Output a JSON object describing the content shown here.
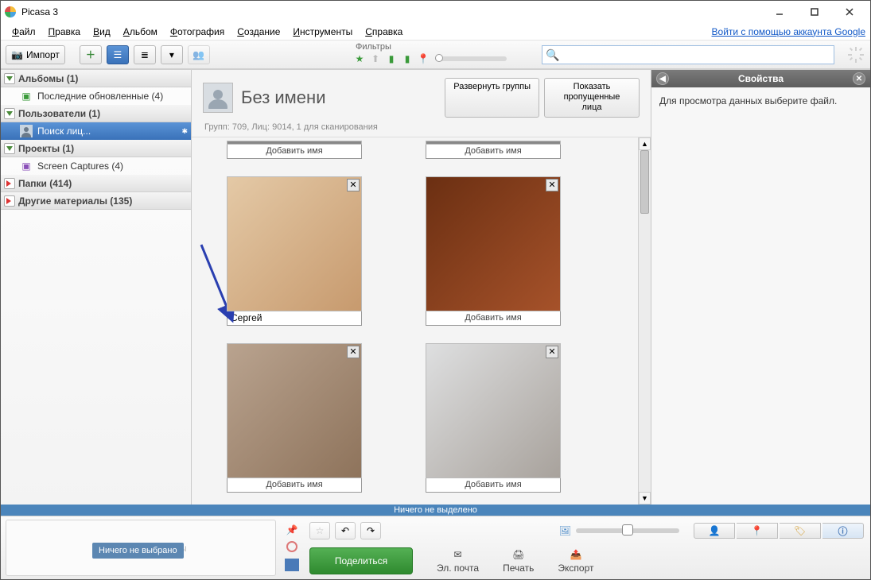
{
  "window": {
    "title": "Picasa 3"
  },
  "menu": {
    "items": [
      "Файл",
      "Правка",
      "Вид",
      "Альбом",
      "Фотография",
      "Создание",
      "Инструменты",
      "Справка"
    ],
    "signin": "Войти с помощью аккаунта Google"
  },
  "toolbar": {
    "import": "Импорт",
    "filters_label": "Фильтры"
  },
  "sidebar": {
    "sections": {
      "albums": {
        "label": "Альбомы (1)",
        "items": [
          "Последние обновленные (4)"
        ]
      },
      "people": {
        "label": "Пользователи (1)",
        "items": [
          "Поиск лиц..."
        ]
      },
      "projects": {
        "label": "Проекты (1)",
        "items": [
          "Screen Captures (4)"
        ]
      },
      "folders": {
        "label": "Папки (414)"
      },
      "other": {
        "label": "Другие материалы (135)"
      }
    }
  },
  "content": {
    "title": "Без имени",
    "expand_btn": "Развернуть группы",
    "show_missed_btn": "Показать пропущенные лица",
    "stats": "Групп: 709, Лиц: 9014, 1 для сканирования",
    "add_name": "Добавить имя",
    "entered_name": "Сергей"
  },
  "properties": {
    "title": "Свойства",
    "empty": "Для просмотра данных выберите файл."
  },
  "status": "Ничего не выделено",
  "bottom": {
    "tooltip": "Ничего не выбрано",
    "hint": "енты",
    "share": "Поделиться",
    "tools": {
      "email": "Эл. почта",
      "print": "Печать",
      "export": "Экспорт"
    }
  },
  "face_colors": {
    "f1": "linear-gradient(135deg,#e4c9a6,#c79a6e)",
    "f2": "linear-gradient(135deg,#6b2f12,#a6522a)",
    "f3": "linear-gradient(135deg,#b9a38f,#8e735b)",
    "f4": "linear-gradient(135deg,#dedfe0,#a8a29c)"
  }
}
